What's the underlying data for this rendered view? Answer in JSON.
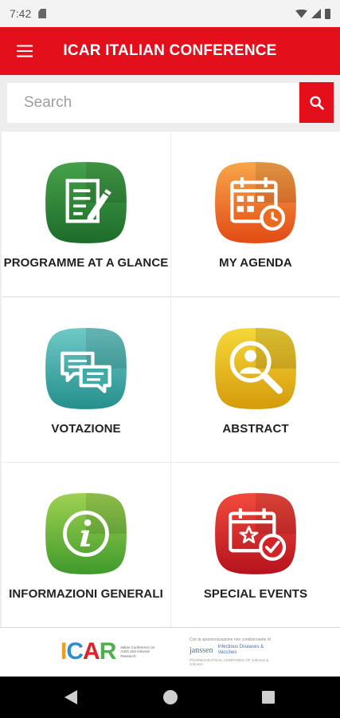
{
  "status_bar": {
    "time": "7:42"
  },
  "app_bar": {
    "title": "ICAR ITALIAN CONFERENCE"
  },
  "search": {
    "placeholder": "Search"
  },
  "tiles": [
    {
      "label": "PROGRAMME AT A GLANCE",
      "icon": "document-pencil-icon",
      "color_top": "#46a24a",
      "color_bottom": "#1d6b2a"
    },
    {
      "label": "MY AGENDA",
      "icon": "calendar-clock-icon",
      "color_top": "#f7a64a",
      "color_bottom": "#e24a14"
    },
    {
      "label": "VOTAZIONE",
      "icon": "chat-bubbles-icon",
      "color_top": "#6fc9c6",
      "color_bottom": "#258f8c"
    },
    {
      "label": "ABSTRACT",
      "icon": "user-magnifier-icon",
      "color_top": "#f6d83a",
      "color_bottom": "#d59a0a"
    },
    {
      "label": "INFORMAZIONI GENERALI",
      "icon": "info-icon",
      "color_top": "#9fd152",
      "color_bottom": "#3f9a2b"
    },
    {
      "label": "SPECIAL EVENTS",
      "icon": "calendar-star-icon",
      "color_top": "#f24a3d",
      "color_bottom": "#b5121d"
    }
  ],
  "footer": {
    "icar_logo": {
      "letters": [
        "I",
        "C",
        "A",
        "R"
      ],
      "colors": [
        "#f29c1e",
        "#2d8fd0",
        "#e31f26",
        "#4db14a"
      ],
      "subtitle": "Italian Conference on AIDS and Antiviral Research"
    },
    "sponsor": {
      "top_text": "Con la sponsorizzazione non condizionante di",
      "name": "janssen",
      "division": "Infectious Diseases & Vaccines",
      "bottom_text": "PHARMACEUTICAL COMPANIES OF Johnson & Johnson"
    }
  },
  "colors": {
    "accent": "#e3101c",
    "background": "#ededed"
  }
}
